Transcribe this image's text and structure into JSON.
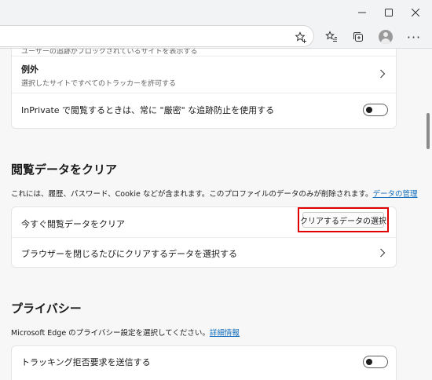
{
  "window_controls": {
    "minimize": "─",
    "maximize": "☐",
    "close": "✕"
  },
  "toolbar": {
    "icons": [
      "star-add-icon",
      "favorites-icon",
      "collections-icon",
      "profile-icon",
      "more-icon"
    ],
    "more_glyph": "···"
  },
  "tracking_card": {
    "partial_text": "ユーザーの追跡がブロックされているサイトを表示する",
    "exceptions_title": "例外",
    "exceptions_sub": "選択したサイトですべてのトラッカーを許可する",
    "inprivate_label": "InPrivate で閲覧するときは、常に \"厳密\" な追跡防止を使用する",
    "inprivate_toggle": false
  },
  "clear_section": {
    "title": "閲覧データをクリア",
    "description": "これには、履歴、パスワード、Cookie などが含まれます。このプロファイルのデータのみが削除されます。",
    "manage_link": "データの管理",
    "clear_now_label": "今すぐ閲覧データをクリア",
    "choose_button": "クリアするデータの選択",
    "on_close_label": "ブラウザーを閉じるたびにクリアするデータを選択する"
  },
  "privacy_section": {
    "title": "プライバシー",
    "description": "Microsoft Edge のプライバシー設定を選択してください。",
    "learn_more_link": "詳細情報",
    "dnt_label": "トラッキング拒否要求を送信する",
    "dnt_toggle": false
  }
}
